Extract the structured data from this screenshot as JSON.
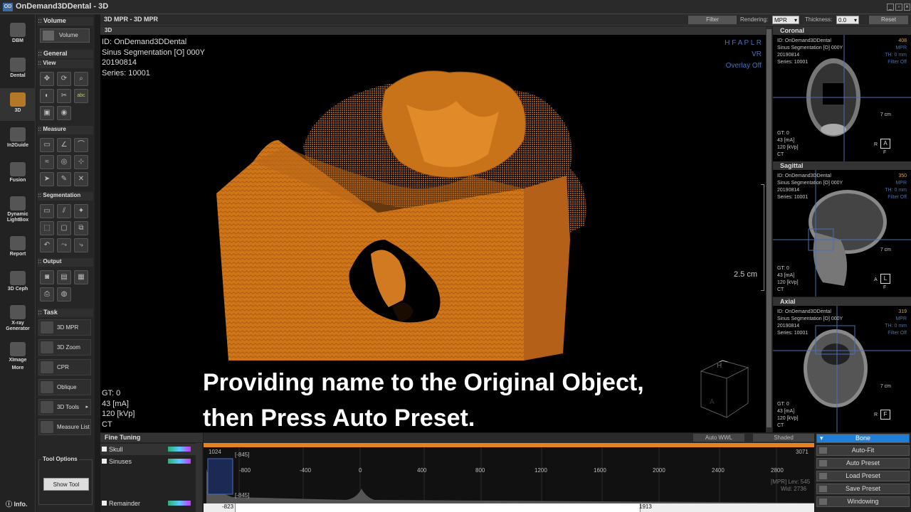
{
  "window": {
    "title": "OnDemand3DDental - 3D",
    "icon": "OD"
  },
  "leftbar": [
    {
      "label": "DBM",
      "icon": "database-icon"
    },
    {
      "label": "Dental",
      "icon": "tooth-icon"
    },
    {
      "label": "3D",
      "icon": "skull-3d-icon"
    },
    {
      "label": "In2Guide",
      "icon": "guide-icon"
    },
    {
      "label": "Fusion",
      "icon": "fusion-icon"
    },
    {
      "label": "Dynamic LightBox",
      "icon": "lightbox-icon"
    },
    {
      "label": "Report",
      "icon": "report-icon"
    },
    {
      "label": "3D Ceph",
      "icon": "ceph-icon"
    },
    {
      "label": "X-ray Generator",
      "icon": "xray-icon"
    },
    {
      "label": "XImage",
      "icon": "ximage-icon"
    },
    {
      "label": "More",
      "icon": "more-icon"
    }
  ],
  "tools": {
    "volume_section": "Volume",
    "volume_button": "Volume",
    "general_section": "General",
    "view_section": "View",
    "measure_section": "Measure",
    "segmentation_section": "Segmentation",
    "output_section": "Output",
    "task_section": "Task",
    "tasks": [
      "3D MPR",
      "3D Zoom",
      "CPR",
      "Oblique",
      "3D Tools",
      "Measure List"
    ],
    "tool_options_label": "Tool Options",
    "show_tool_label": "Show Tool",
    "info_label": "Info."
  },
  "toolbar": {
    "breadcrumb": "3D MPR - 3D MPR",
    "filter_label": "Filter",
    "rendering_label": "Rendering:",
    "rendering_value": "MPR",
    "thickness_label": "Thickness:",
    "thickness_value": "0.0",
    "reset_label": "Reset"
  },
  "viewer": {
    "header": "3D",
    "id_line": "ID: OnDemand3DDental",
    "series_name": "Sinus Segmentation [O] 000Y",
    "date": "20190814",
    "series": "Series: 10001",
    "orientation": "H F A P L R",
    "mode": "VR",
    "overlay": "Overlay Off",
    "scale": "2.5 cm",
    "gt": "GT: 0",
    "ma": "43 [mA]",
    "kvp": "120 [kVp]",
    "modality": "CT",
    "cube_top": "H",
    "cube_front": "A",
    "subtitle_line1": "Providing name to the Original Object,",
    "subtitle_line2": "then Press Auto Preset."
  },
  "mini_views": [
    {
      "title": "Coronal",
      "slice": "408",
      "id": "ID: OnDemand3DDental",
      "name": "Sinus Segmentation [O] 000Y",
      "date": "20190814",
      "series": "Series: 10001",
      "mode": "MPR",
      "th": "TH: 0 mm",
      "filter": "Filter Off",
      "gt": "GT: 0",
      "ma": "43 [mA]",
      "kvp": "120 [kVp]",
      "modality": "CT",
      "scale": "7 cm",
      "left_orient": "R",
      "box": "A",
      "bottom": "F"
    },
    {
      "title": "Sagittal",
      "slice": "350",
      "id": "ID: OnDemand3DDental",
      "name": "Sinus Segmentation [O] 000Y",
      "date": "20190814",
      "series": "Series: 10001",
      "mode": "MPR",
      "th": "TH: 0 mm",
      "filter": "Filter Off",
      "gt": "GT: 0",
      "ma": "43 [mA]",
      "kvp": "120 [kVp]",
      "modality": "CT",
      "scale": "7 cm",
      "left_orient": "A",
      "box": "L",
      "bottom": "F"
    },
    {
      "title": "Axial",
      "slice": "319",
      "id": "ID: OnDemand3DDental",
      "name": "Sinus Segmentation [O] 000Y",
      "date": "20190814",
      "series": "Series: 10001",
      "mode": "MPR",
      "th": "TH: 0 mm",
      "filter": "Filter Off",
      "gt": "GT: 0",
      "ma": "43 [mA]",
      "kvp": "120 [kVp]",
      "modality": "CT",
      "scale": "7 cm",
      "left_orient": "R",
      "box": "F",
      "bottom": ""
    }
  ],
  "fine_tuning": {
    "title": "Fine Tuning",
    "objects": [
      "Skull",
      "Sinuses",
      "Remainder"
    ]
  },
  "histogram": {
    "auto_wwl": "Auto WWL",
    "shaded": "Shaded",
    "preset": "Bone",
    "ticks": [
      "-800",
      "-400",
      "0",
      "400",
      "800",
      "1200",
      "1600",
      "2000",
      "2400",
      "2800"
    ],
    "max": "3071",
    "top_left": "1024",
    "marker_top": "[-845]",
    "marker_bottom": "[-845]",
    "low_value": "-823",
    "high_value": "1913",
    "lev": "[MPR] Lev: 545",
    "wid": "Wid: 2736"
  },
  "right_buttons": [
    "Auto-Fit",
    "Auto Preset",
    "Load Preset",
    "Save Preset",
    "Windowing"
  ],
  "colors": {
    "accent": "#e8821f",
    "bone": "#1f7fd6",
    "overlay": "#4a6fb5",
    "render": "#c86a14"
  }
}
